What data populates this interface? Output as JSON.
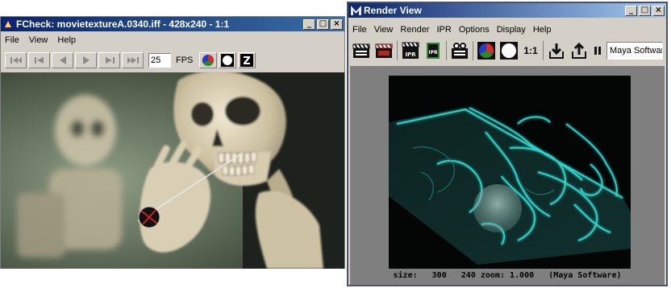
{
  "fcheck": {
    "title": "FCheck: movietextureA.0340.iff - 428x240 - 1:1",
    "menu": [
      "File",
      "View",
      "Help"
    ],
    "vcr_buttons": [
      "first-frame",
      "step-back-start",
      "play-backward",
      "play-forward",
      "step-forward-end",
      "last-frame"
    ],
    "fps_value": "25",
    "fps_label": "FPS"
  },
  "render_view": {
    "title": "Render View",
    "menu": [
      "File",
      "View",
      "Render",
      "IPR",
      "Options",
      "Display",
      "Help"
    ],
    "zoom_label": "1:1",
    "renderer": "Maya Software",
    "status": {
      "size_label": "size:",
      "width": "300",
      "height": "240",
      "zoom_label": "zoom:",
      "zoom": "1.000",
      "renderer": "(Maya Software)"
    }
  },
  "colors": {
    "titlebar_active": "#0a246a",
    "window_face": "#d4d0c8",
    "render_glow": "#35e0d8"
  }
}
